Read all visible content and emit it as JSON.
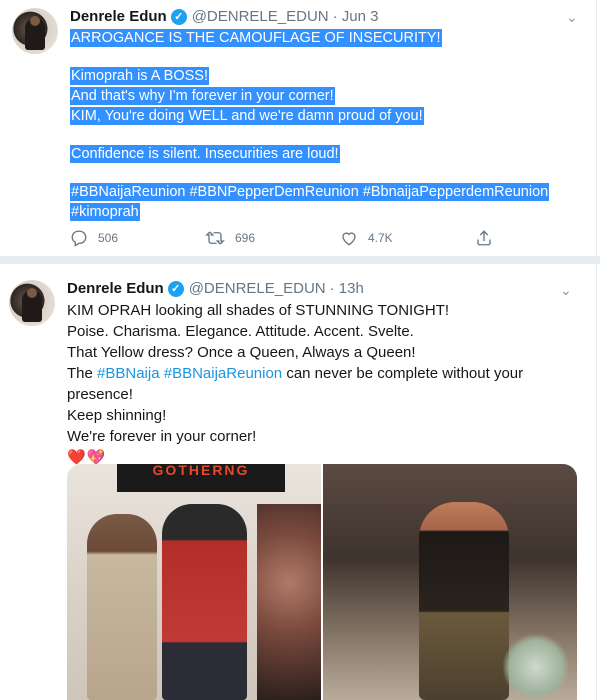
{
  "tweet1": {
    "name": "Denrele Edun",
    "handle": "@DENRELE_EDUN",
    "time": "· Jun 3",
    "lines": [
      "ARROGANCE IS THE CAMOUFLAGE OF INSECURITY!",
      "Kimoprah is A BOSS!",
      "And that's why I'm forever in your corner!",
      "KIM, You're doing WELL and we're damn proud of you!",
      "Confidence is silent. Insecurities are loud!",
      "#BBNaijaReunion #BBNPepperDemReunion #BbnaijaPepperdemReunion",
      "#kimoprah"
    ],
    "stats": {
      "replies": "506",
      "retweets": "696",
      "likes": "4.7K"
    }
  },
  "tweet2": {
    "name": "Denrele Edun",
    "handle": "@DENRELE_EDUN",
    "time": "· 13h",
    "lines": {
      "l1": "KIM OPRAH looking all shades of STUNNING TONIGHT!",
      "l2": "Poise. Charisma. Elegance. Attitude. Accent. Svelte.",
      "l3": "That Yellow dress? Once a Queen, Always a Queen!",
      "l4_pre": "The ",
      "l4_tag1": "#BBNaija",
      "l4_space": " ",
      "l4_tag2": "#BBNaijaReunion",
      "l4_post": " can never be complete without your",
      "l5": "presence!",
      "l6": "Keep shinning!",
      "l7": "We're forever in your corner!",
      "emoji": "❤️💖"
    },
    "media": {
      "banner_text": "GOTHERNG"
    }
  },
  "colors": {
    "highlight": "#3390ff",
    "link": "#1b95e0",
    "verified": "#1da1f2",
    "muted": "#657786"
  }
}
